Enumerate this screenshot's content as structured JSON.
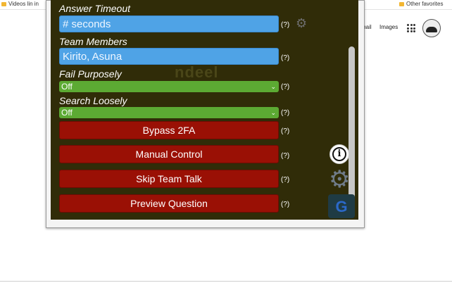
{
  "browser": {
    "bookmarks": [
      "Videos lin in",
      "Other favorites"
    ],
    "google_links": [
      "mail",
      "Images"
    ]
  },
  "panel": {
    "answer_timeout": {
      "label": "Answer Timeout",
      "placeholder": "# seconds",
      "help": "(?)"
    },
    "team_members": {
      "label": "Team Members",
      "value": "Kirito, Asuna",
      "help": "(?)"
    },
    "fail_purposely": {
      "label": "Fail Purposely",
      "selected": "Off",
      "help": "(?)"
    },
    "search_loosely": {
      "label": "Search Loosely",
      "selected": "Off",
      "help": "(?)"
    },
    "buttons": [
      {
        "label": "Bypass 2FA",
        "help": "(?)"
      },
      {
        "label": "Manual Control",
        "help": "(?)"
      },
      {
        "label": "Skip Team Talk",
        "help": "(?)"
      },
      {
        "label": "Preview Question",
        "help": "(?)"
      }
    ],
    "settings_gear_icon": "gear-icon",
    "info_icon": "info-icon",
    "background_title": "ndeel"
  },
  "colors": {
    "panel_bg": "#302c08",
    "input_blue": "#4fa3e6",
    "select_green": "#5caa33",
    "button_red": "#9a1005"
  }
}
